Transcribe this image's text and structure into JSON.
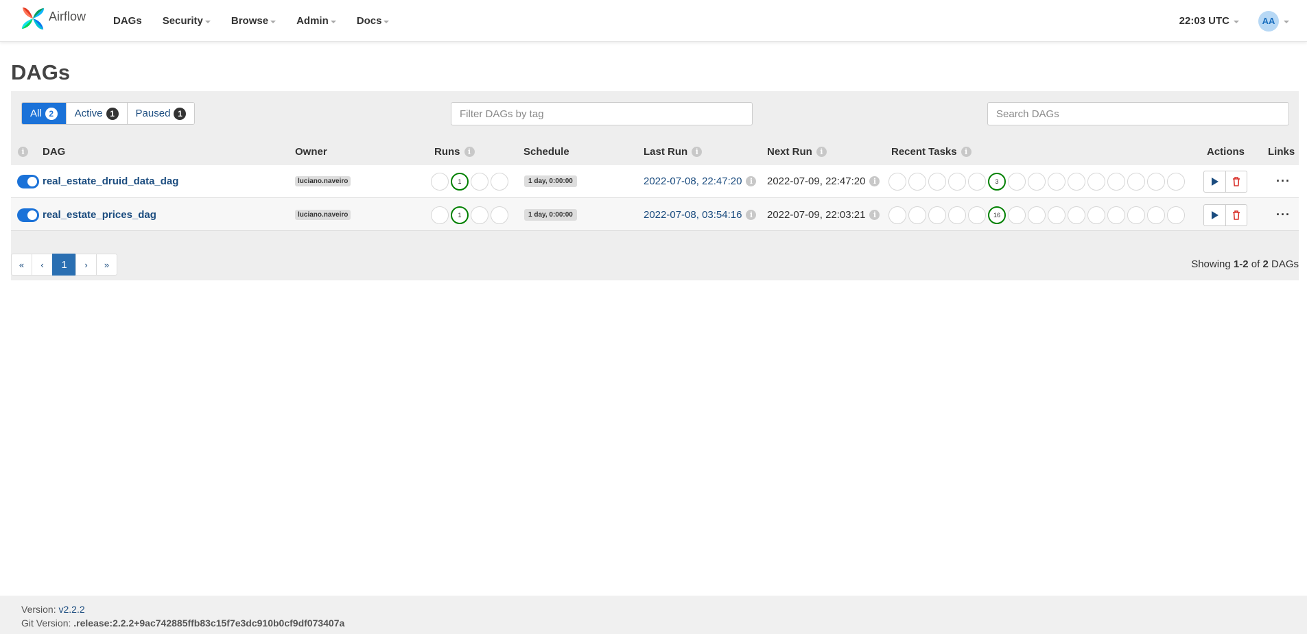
{
  "navbar": {
    "brand": "Airflow",
    "menu": [
      "DAGs",
      "Security",
      "Browse",
      "Admin",
      "Docs"
    ],
    "clock": "22:03 UTC",
    "avatar": "AA"
  },
  "page": {
    "title": "DAGs"
  },
  "filters": {
    "all_label": "All",
    "all_count": "2",
    "active_label": "Active",
    "active_count": "1",
    "paused_label": "Paused",
    "paused_count": "1",
    "tag_placeholder": "Filter DAGs by tag",
    "search_placeholder": "Search DAGs"
  },
  "table": {
    "headers": {
      "dag": "DAG",
      "owner": "Owner",
      "runs": "Runs",
      "schedule": "Schedule",
      "last_run": "Last Run",
      "next_run": "Next Run",
      "recent_tasks": "Recent Tasks",
      "actions": "Actions",
      "links": "Links"
    },
    "rows": [
      {
        "dag_id": "real_estate_druid_data_dag",
        "owner": "luciano.naveiro",
        "schedule": "1 day, 0:00:00",
        "last_run": "2022-07-08, 22:47:20",
        "next_run": "2022-07-09, 22:47:20",
        "runs_count": "1",
        "recent_tasks_count": "3"
      },
      {
        "dag_id": "real_estate_prices_dag",
        "owner": "luciano.naveiro",
        "schedule": "1 day, 0:00:00",
        "last_run": "2022-07-08, 03:54:16",
        "next_run": "2022-07-09, 22:03:21",
        "runs_count": "1",
        "recent_tasks_count": "16"
      }
    ]
  },
  "pagination": {
    "first": "«",
    "prev": "‹",
    "current": "1",
    "next": "›",
    "last": "»",
    "showing_prefix": "Showing",
    "showing_range": "1-2",
    "showing_of": "of",
    "showing_total": "2",
    "showing_suffix": "DAGs"
  },
  "footer": {
    "version_label": "Version:",
    "version": "v2.2.2",
    "git_label": "Git Version:",
    "git_version": ".release:2.2.2+9ac742885ffb83c15f7e3dc910b0cf9df073407a"
  },
  "colors": {
    "accent": "#1b72d8",
    "link": "#1b4c7f",
    "success": "#008000",
    "delete": "#d9302a"
  }
}
